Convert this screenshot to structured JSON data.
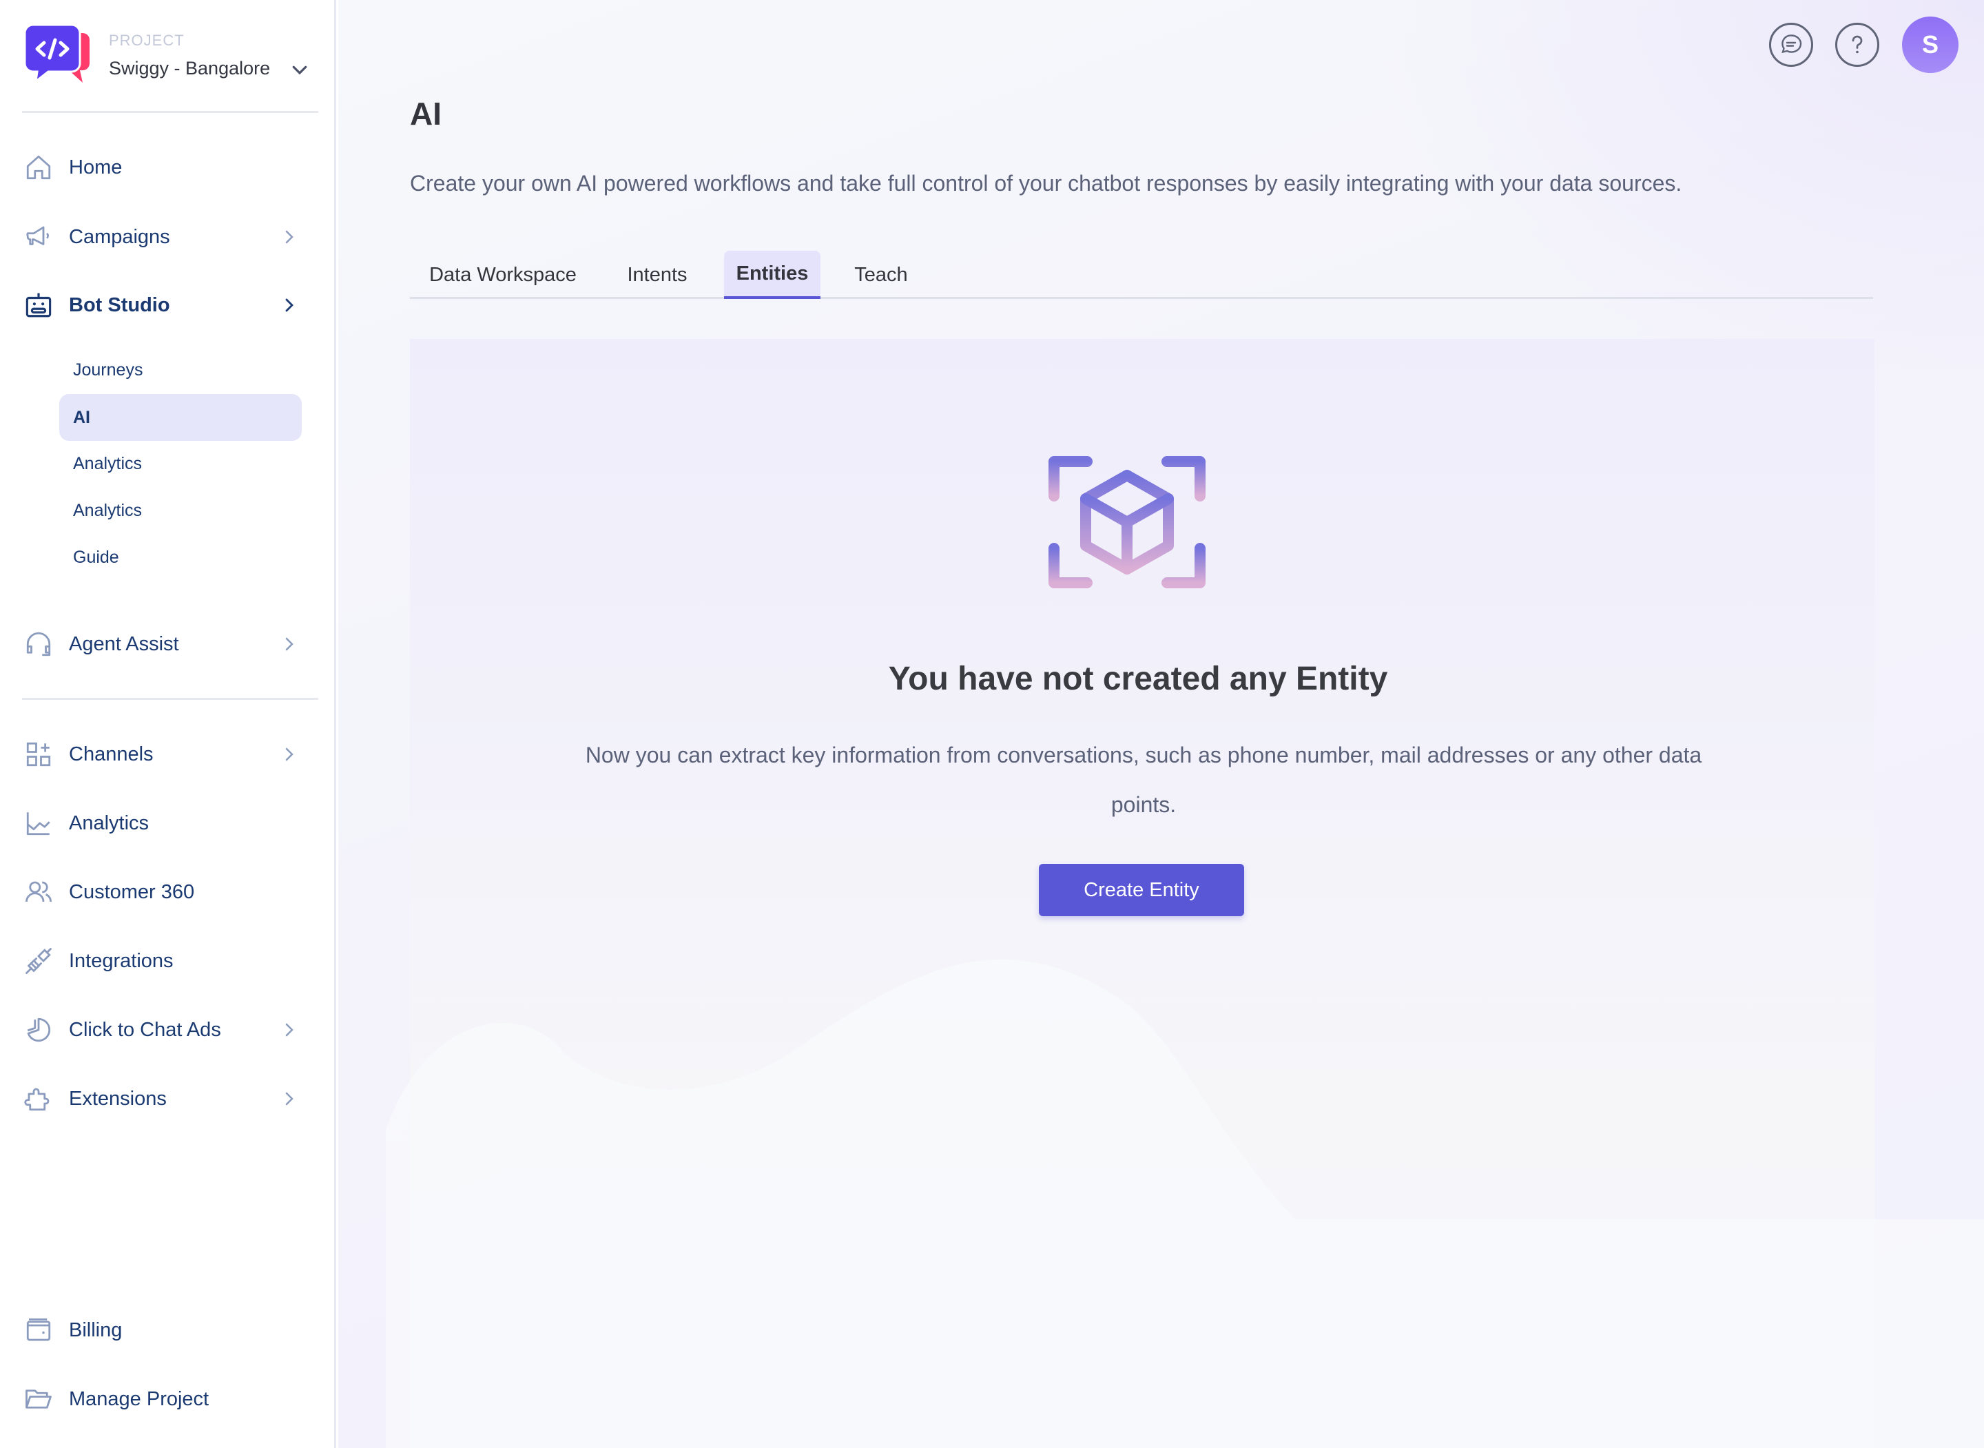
{
  "project": {
    "label": "PROJECT",
    "name": "Swiggy - Bangalore"
  },
  "sidebar": {
    "items": [
      {
        "label": "Home",
        "icon": "home-icon"
      },
      {
        "label": "Campaigns",
        "icon": "megaphone-icon",
        "has_chevron": true
      },
      {
        "label": "Bot Studio",
        "icon": "bot-icon",
        "has_chevron": true,
        "expanded": true
      },
      {
        "label": "Agent Assist",
        "icon": "headset-icon",
        "has_chevron": true
      },
      {
        "label": "Channels",
        "icon": "grid-plus-icon",
        "has_chevron": true
      },
      {
        "label": "Analytics",
        "icon": "line-chart-icon"
      },
      {
        "label": "Customer 360",
        "icon": "users-icon"
      },
      {
        "label": "Integrations",
        "icon": "plug-icon"
      },
      {
        "label": "Click to Chat Ads",
        "icon": "pie-chart-icon",
        "has_chevron": true
      },
      {
        "label": "Extensions",
        "icon": "puzzle-icon",
        "has_chevron": true
      },
      {
        "label": "Billing",
        "icon": "wallet-icon"
      },
      {
        "label": "Manage Project",
        "icon": "folder-icon"
      }
    ],
    "bot_studio_sub": [
      {
        "label": "Journeys"
      },
      {
        "label": "AI",
        "active": true
      },
      {
        "label": "Analytics"
      },
      {
        "label": "Analytics"
      },
      {
        "label": "Guide"
      }
    ]
  },
  "header": {
    "chat_icon": "chat-bubble-icon",
    "help_icon": "question-icon",
    "avatar_initial": "S"
  },
  "page": {
    "title": "AI",
    "description": "Create your own AI powered workflows and take full control of your chatbot responses by easily integrating with your data sources.",
    "tabs": [
      {
        "label": "Data Workspace"
      },
      {
        "label": "Intents"
      },
      {
        "label": "Entities",
        "active": true
      },
      {
        "label": "Teach"
      }
    ]
  },
  "empty_state": {
    "icon": "cube-scan-icon",
    "title": "You have not created any Entity",
    "description": "Now you can extract key information from conversations, such as phone number, mail addresses or any other data points.",
    "button_label": "Create Entity"
  },
  "colors": {
    "accent": "#5a57d6",
    "nav_text": "#1b3a72",
    "nav_icon": "#8b9bbd",
    "active_bg": "#e6e6fb",
    "avatar": "#9a7ef6",
    "logo_purple": "#5b3df0",
    "logo_pink": "#ff3b6b"
  }
}
